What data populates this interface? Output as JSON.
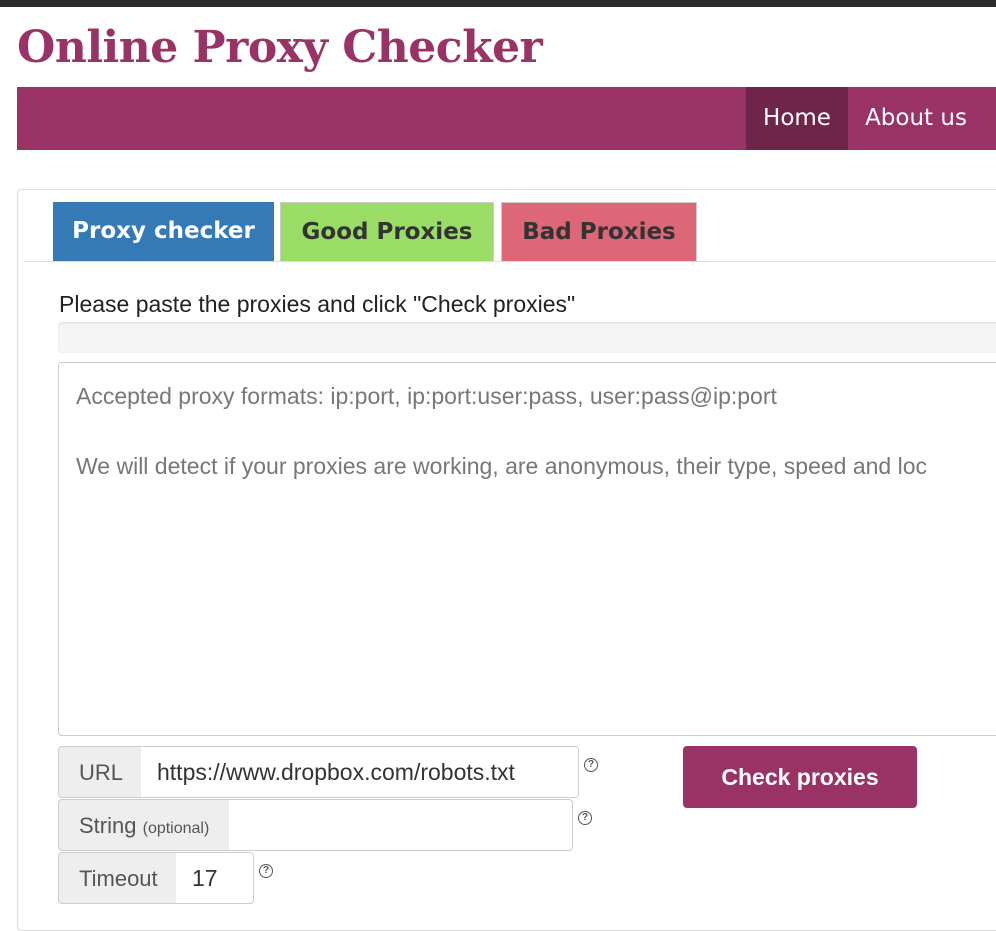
{
  "site": {
    "title": "Online Proxy Checker"
  },
  "nav": {
    "items": [
      {
        "label": "Home"
      },
      {
        "label": "About us"
      }
    ]
  },
  "tabs": [
    {
      "label": "Proxy checker",
      "color": "#337ab7",
      "active": true
    },
    {
      "label": "Good Proxies",
      "color": "#99dd66"
    },
    {
      "label": "Bad Proxies",
      "color": "#dd6677"
    }
  ],
  "checker": {
    "instruction": "Please paste the proxies and click \"Check proxies\"",
    "progress": 0,
    "placeholder_line1": "Accepted proxy formats: ip:port, ip:port:user:pass, user:pass@ip:port",
    "placeholder_line2": "We will detect if your proxies are working, are anonymous, their type, speed and loc",
    "url_label": "URL",
    "url_value": "https://www.dropbox.com/robots.txt",
    "string_label": "String",
    "string_optional": "(optional)",
    "string_value": "",
    "timeout_label": "Timeout",
    "timeout_value": "17",
    "help_icon": "?",
    "check_button": "Check proxies"
  },
  "colors": {
    "brand": "#993366",
    "nav_active": "#6e2549"
  }
}
